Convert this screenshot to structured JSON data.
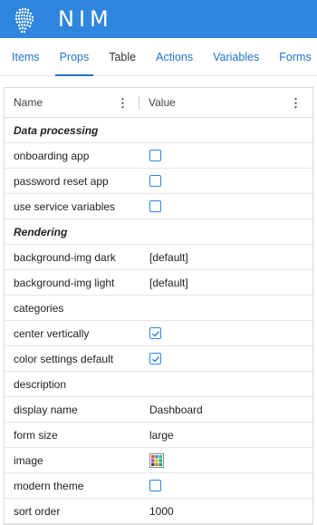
{
  "app": {
    "title": "NIM",
    "logo_icon": "fingerprint-head-icon",
    "brand_color": "#2f86de"
  },
  "tabs": [
    {
      "label": "Items",
      "active": false
    },
    {
      "label": "Props",
      "active": true
    },
    {
      "label": "Table",
      "active": false
    },
    {
      "label": "Actions",
      "active": false
    },
    {
      "label": "Variables",
      "active": false
    },
    {
      "label": "Forms",
      "active": false
    }
  ],
  "grid": {
    "columns": {
      "name": "Name",
      "value": "Value"
    },
    "sections": [
      {
        "title": "Data processing",
        "rows": [
          {
            "name": "onboarding app",
            "type": "checkbox",
            "checked": false
          },
          {
            "name": "password reset app",
            "type": "checkbox",
            "checked": false
          },
          {
            "name": "use service variables",
            "type": "checkbox",
            "checked": false
          }
        ]
      },
      {
        "title": "Rendering",
        "rows": [
          {
            "name": "background-img dark",
            "type": "text",
            "value": "[default]"
          },
          {
            "name": "background-img light",
            "type": "text",
            "value": "[default]"
          },
          {
            "name": "categories",
            "type": "text",
            "value": ""
          },
          {
            "name": "center vertically",
            "type": "checkbox",
            "checked": true
          },
          {
            "name": "color settings default",
            "type": "checkbox",
            "checked": true
          },
          {
            "name": "description",
            "type": "text",
            "value": ""
          },
          {
            "name": "display name",
            "type": "text",
            "value": "Dashboard"
          },
          {
            "name": "form size",
            "type": "text",
            "value": "large"
          },
          {
            "name": "image",
            "type": "image",
            "icon": "tile-image-icon"
          },
          {
            "name": "modern theme",
            "type": "checkbox",
            "checked": false
          },
          {
            "name": "sort order",
            "type": "text",
            "value": "1000"
          }
        ]
      }
    ]
  }
}
